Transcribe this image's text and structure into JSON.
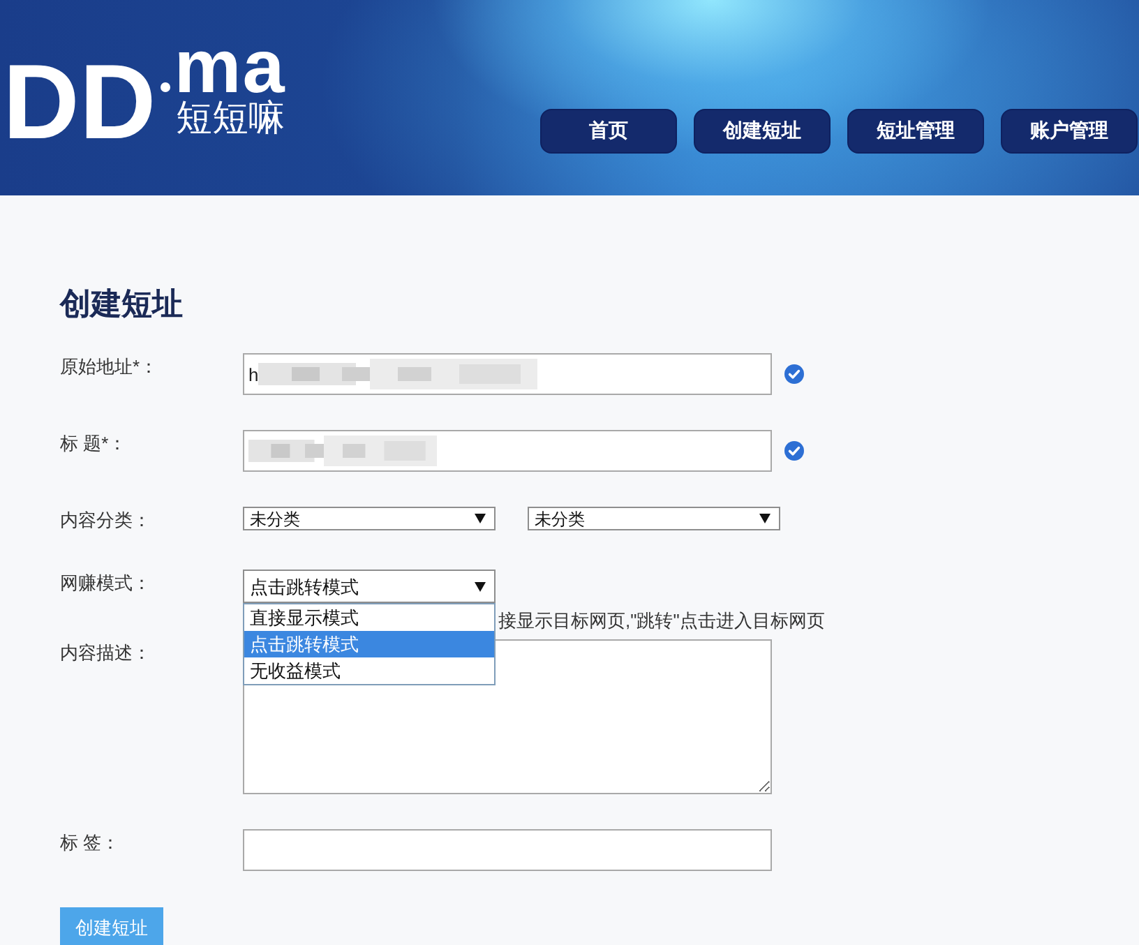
{
  "logo": {
    "mark": "DD",
    "suffix": "ma",
    "tagline": "短短嘛"
  },
  "nav": [
    {
      "label": "首页"
    },
    {
      "label": "创建短址"
    },
    {
      "label": "短址管理"
    },
    {
      "label": "账户管理"
    }
  ],
  "form": {
    "title": "创建短址",
    "fields": [
      {
        "kind": "text",
        "label": "原始地址*：",
        "value": "h",
        "redacted": true,
        "valid": true
      },
      {
        "kind": "text",
        "label": "标 题*：",
        "redacted": true,
        "valid": true
      },
      {
        "kind": "selects",
        "label": "内容分类：",
        "selects": [
          {
            "value": "未分类"
          },
          {
            "value": "未分类"
          }
        ]
      },
      {
        "kind": "dropdown",
        "label": "网赚模式：",
        "value": "点击跳转模式",
        "expanded": true,
        "options": [
          {
            "label": "直接显示模式",
            "selected": false
          },
          {
            "label": "点击跳转模式",
            "selected": true
          },
          {
            "label": "无收益模式",
            "selected": false
          }
        ],
        "hint": "接显示目标网页,\"跳转\"点击进入目标网页"
      },
      {
        "kind": "textarea",
        "label": "内容描述："
      },
      {
        "kind": "text",
        "label": "标 签："
      }
    ],
    "submit": "创建短址"
  }
}
